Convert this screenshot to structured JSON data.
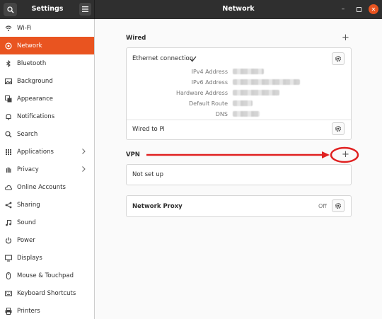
{
  "titlebar": {
    "left_title": "Settings",
    "center_title": "Network"
  },
  "sidebar": {
    "items": [
      {
        "label": "Wi-Fi",
        "icon": "wifi-icon"
      },
      {
        "label": "Network",
        "icon": "network-icon",
        "active": true
      },
      {
        "label": "Bluetooth",
        "icon": "bluetooth-icon"
      },
      {
        "label": "Background",
        "icon": "background-icon"
      },
      {
        "label": "Appearance",
        "icon": "appearance-icon"
      },
      {
        "label": "Notifications",
        "icon": "bell-icon"
      },
      {
        "label": "Search",
        "icon": "search-icon"
      },
      {
        "label": "Applications",
        "icon": "grid-icon",
        "chevron": true
      },
      {
        "label": "Privacy",
        "icon": "hand-icon",
        "chevron": true
      },
      {
        "label": "Online Accounts",
        "icon": "cloud-icon"
      },
      {
        "label": "Sharing",
        "icon": "share-icon"
      },
      {
        "label": "Sound",
        "icon": "music-note-icon"
      },
      {
        "label": "Power",
        "icon": "power-icon"
      },
      {
        "label": "Displays",
        "icon": "display-icon"
      },
      {
        "label": "Mouse & Touchpad",
        "icon": "mouse-icon"
      },
      {
        "label": "Keyboard Shortcuts",
        "icon": "keyboard-icon"
      },
      {
        "label": "Printers",
        "icon": "printer-icon"
      }
    ]
  },
  "wired": {
    "label": "Wired",
    "connection_name": "Ethernet connection",
    "details": [
      {
        "key": "IPv4 Address"
      },
      {
        "key": "IPv6 Address"
      },
      {
        "key": "Hardware Address"
      },
      {
        "key": "Default Route"
      },
      {
        "key": "DNS"
      }
    ],
    "second_connection": "Wired to Pi"
  },
  "vpn": {
    "label": "VPN",
    "status": "Not set up"
  },
  "proxy": {
    "label": "Network Proxy",
    "status": "Off"
  },
  "colors": {
    "accent": "#e95420",
    "titlebar": "#2f2f2f",
    "annotation": "#e02020"
  }
}
